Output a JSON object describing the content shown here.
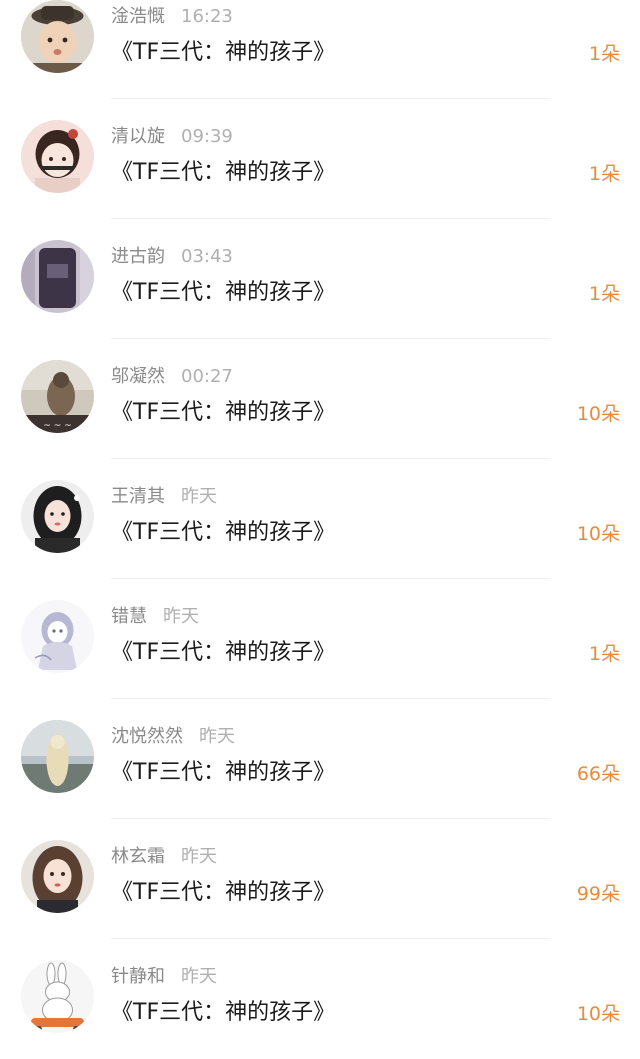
{
  "gift_list": {
    "items": [
      {
        "user": "淦浩慨",
        "time": "16:23",
        "title": "《TF三代：神的孩子》",
        "count": "1朵",
        "avatar_bg": "#dcd6cc",
        "avatar_fg": "#6b5a48"
      },
      {
        "user": "清以旋",
        "time": "09:39",
        "title": "《TF三代：神的孩子》",
        "count": "1朵",
        "avatar_bg": "#f4dfda",
        "avatar_fg": "#5a3a32"
      },
      {
        "user": "进古韵",
        "time": "03:43",
        "title": "《TF三代：神的孩子》",
        "count": "1朵",
        "avatar_bg": "#c9c3cf",
        "avatar_fg": "#4a3f55"
      },
      {
        "user": "邬凝然",
        "time": "00:27",
        "title": "《TF三代：神的孩子》",
        "count": "10朵",
        "avatar_bg": "#cfc8bd",
        "avatar_fg": "#7a6653"
      },
      {
        "user": "王清其",
        "time": "昨天",
        "title": "《TF三代：神的孩子》",
        "count": "10朵",
        "avatar_bg": "#eeeeee",
        "avatar_fg": "#1e1e1e"
      },
      {
        "user": "错慧",
        "time": "昨天",
        "title": "《TF三代：神的孩子》",
        "count": "1朵",
        "avatar_bg": "#f7f7fa",
        "avatar_fg": "#9a9ab8"
      },
      {
        "user": "沈悦然然",
        "time": "昨天",
        "title": "《TF三代：神的孩子》",
        "count": "66朵",
        "avatar_bg": "#b9c2c8",
        "avatar_fg": "#e8dcb8"
      },
      {
        "user": "林玄霜",
        "time": "昨天",
        "title": "《TF三代：神的孩子》",
        "count": "99朵",
        "avatar_bg": "#e8e2dc",
        "avatar_fg": "#5a4032"
      },
      {
        "user": "针静和",
        "time": "昨天",
        "title": "《TF三代：神的孩子》",
        "count": "10朵",
        "avatar_bg": "#f6f6f6",
        "avatar_fg": "#e2763c"
      }
    ]
  },
  "colors": {
    "count_color": "#e98b3e",
    "name_color": "#8a8a8a",
    "time_color": "#b0b0b0",
    "title_color": "#1b1b1b"
  }
}
